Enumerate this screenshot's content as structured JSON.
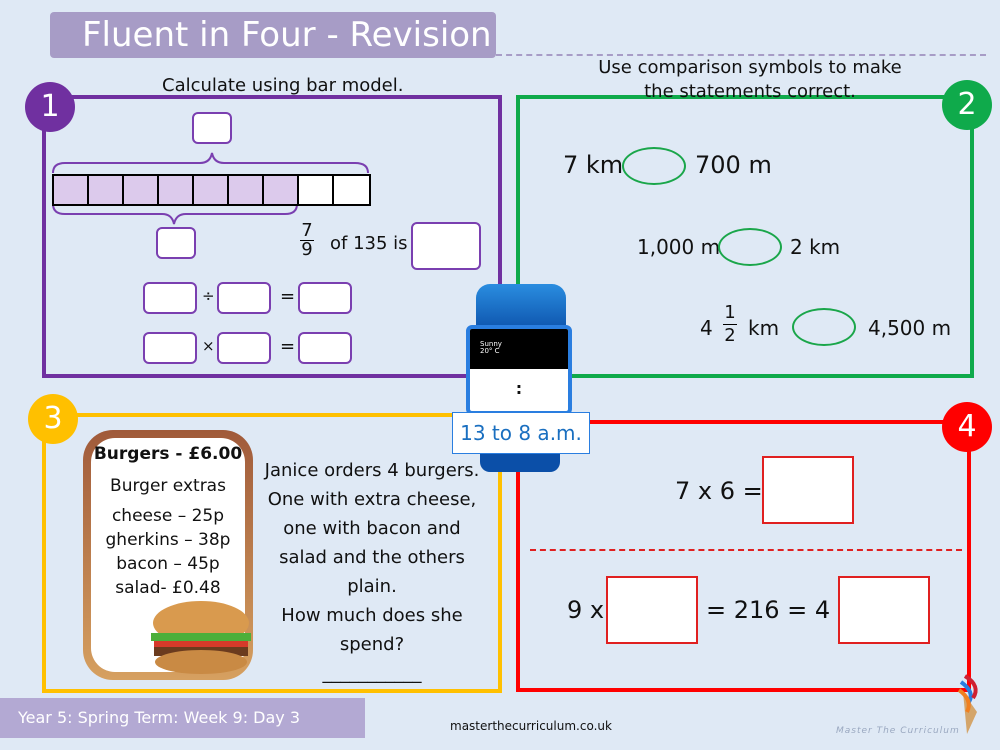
{
  "title": "Fluent in Four - Revision",
  "q1": {
    "number": "1",
    "instruction": "Calculate using bar model.",
    "bar_total_parts": 9,
    "bar_shaded_parts": 7,
    "fraction_num": "7",
    "fraction_den": "9",
    "of_text": "of 135 is",
    "div": "÷",
    "times": "×",
    "eq": "="
  },
  "q2": {
    "number": "2",
    "instruction_line1": "Use comparison symbols to make",
    "instruction_line2": "the statements correct.",
    "rows": [
      {
        "left": "7 km",
        "right": "700 m"
      },
      {
        "left": "1,000 m",
        "right": "2 km"
      },
      {
        "left_whole": "4",
        "left_num": "1",
        "left_den": "2",
        "left_unit": "km",
        "right": "4,500 m"
      }
    ]
  },
  "watch": {
    "weather": "Sunny",
    "temp": "20° C",
    "display": ":",
    "caption": "13 to 8 a.m."
  },
  "q3": {
    "number": "3",
    "menu_title": "Burgers - £6.00",
    "extras_title": "Burger extras",
    "extras": [
      "cheese – 25p",
      "gherkins – 38p",
      "bacon – 45p",
      "salad- £0.48"
    ],
    "question": [
      "Janice orders 4 burgers.",
      "One with extra cheese,",
      "one with bacon and",
      "salad and the others",
      "plain.",
      "How much does she",
      "spend?"
    ],
    "answer_line": "___________"
  },
  "q4": {
    "number": "4",
    "line1": "7 x 6 =",
    "line2_a": "9 x",
    "line2_b": "= 216 = 4 x"
  },
  "footer": {
    "term": "Year 5: Spring Term: Week 9: Day 3",
    "website": "masterthecurriculum.co.uk",
    "logo_text": "Master The Curriculum"
  },
  "colors": {
    "q1": "#7030a0",
    "q2": "#0faa4b",
    "q3": "#ffc000",
    "q4": "#ff0000",
    "title_bg": "#a79cc6"
  }
}
